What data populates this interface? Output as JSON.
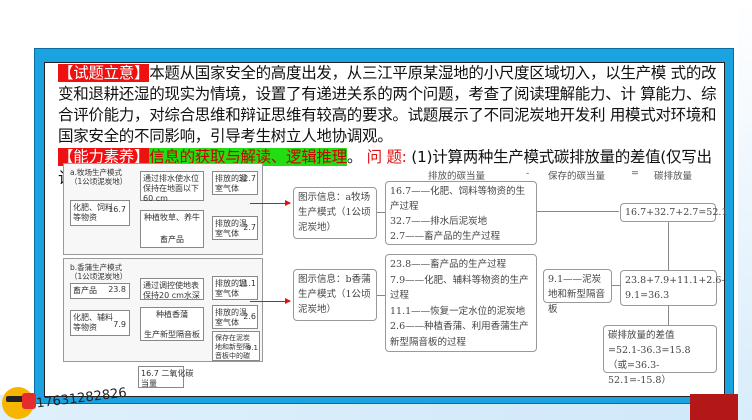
{
  "intent": {
    "tag": "【试题立意】",
    "text": "本题从国家安全的高度出发，从三江平原某湿地的小尺度区域切入，以生产模 式的改变和退耕还湿的现实为情境，设置了有递进关系的两个问题，考查了阅读理解能力、计 算能力、综合评价能力，对综合思维和辩证思维有较高的要求。试题展示了不同泥炭地开发利 用模式对环境和国家安全的不同影响，引导考生树立人地协调观。"
  },
  "ability": {
    "tag": "【能力素养】",
    "text": "信息的获取与解读、逻辑推理",
    "period": "。",
    "q_label": "问 题:",
    "q_text": "(1)计算两种生产模式碳排放量的差值(仅写出计算结果)。"
  },
  "figure": {
    "a_title": "a.牧场生产模式\n（1公顷泥炭地）",
    "a_input": "化肥、饲料\n等物资",
    "a_input_v": "16.7",
    "a_s1": "通过排水使水位\n保持在地面以下\n60 cm",
    "a_s2": "种植牧草、养牛",
    "a_s3": "畜产品",
    "a_e1": "排放的温\n室气体",
    "a_e1_v": "32.7",
    "a_e2": "排放的温\n室气体",
    "a_e2_v": "2.7",
    "b_title": "b.香蒲生产模式\n（1公顷泥炭地）",
    "b_in1": "畜产品",
    "b_in1_v": "23.8",
    "b_in2": "化肥、辅料\n等物资",
    "b_in2_v": "7.9",
    "b_s1": "通过调控使地表\n保持20 cm水深",
    "b_s2": "种植香蒲",
    "b_s3": "生产新型隔音板",
    "b_e1": "排放的温\n室气体",
    "b_e1_v": "11.1",
    "b_e2": "排放的温\n室气体",
    "b_e2_v": "2.6",
    "b_e3": "保存在泥炭\n地和新型隔\n音板中的碳",
    "b_e3_v": "9.1",
    "legend_v": "16.7",
    "legend": "二氧化碳\n当量"
  },
  "flow": {
    "h1": "排放的碳当量",
    "h2": "-",
    "h3": "保存的碳当量",
    "h4": "=",
    "h5": "碳排放量",
    "a_info": "图示信息：a牧场生产模式（1公顷泥炭地）",
    "a_list": "16.7——化肥、饲料等物资的生产过程\n32.7——排水后泥炭地\n2.7——畜产品的生产过程",
    "a_calc": "16.7+32.7+2.7=52.1",
    "b_info": "图示信息：b香蒲生产模式（1公顷泥炭地）",
    "b_list": "23.8——畜产品的生产过程\n7.9——化肥、辅料等物资的生产过程\n11.1——恢复一定水位的泥炭地\n2.6——种植香蒲、利用香蒲生产新型隔音板的过程",
    "b_store": "9.1——泥炭地和新型隔音板",
    "b_calc": "23.8+7.9+11.1+2.6-9.1=36.3",
    "diff": "碳排放量的差值\n=52.1-36.3=15.8\n（或=36.3-52.1=-15.8）"
  },
  "footer": {
    "phone": "17631282826"
  }
}
